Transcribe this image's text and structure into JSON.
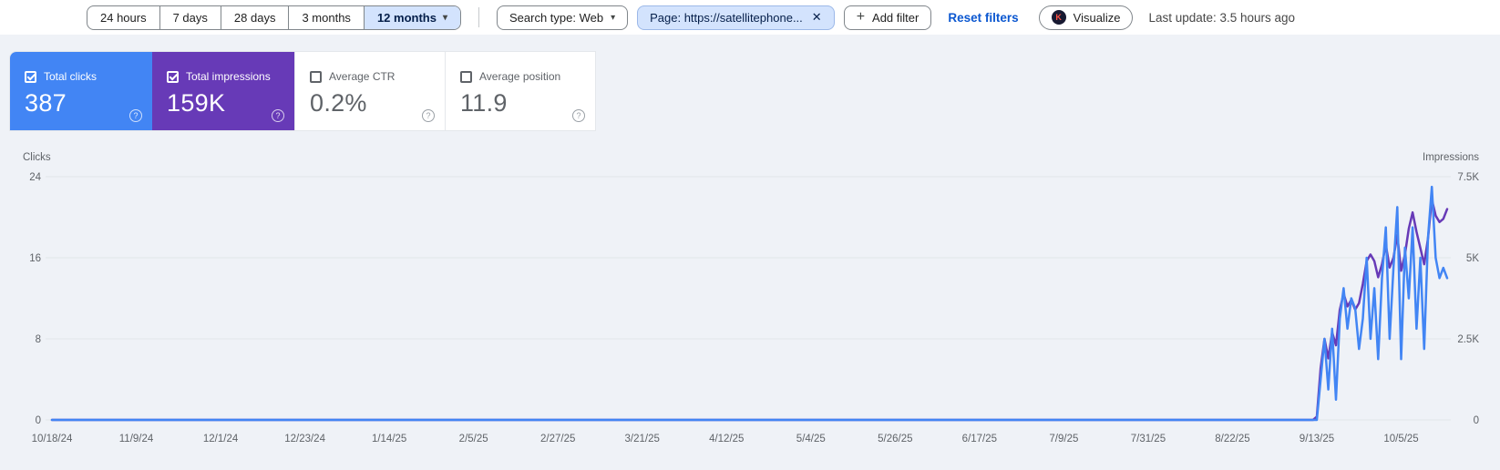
{
  "icons": {
    "caret": "▾",
    "close": "✕",
    "add": "+",
    "help": "?",
    "visualize_logo": "K"
  },
  "toolbar": {
    "date_ranges": [
      {
        "label": "24 hours",
        "selected": false
      },
      {
        "label": "7 days",
        "selected": false
      },
      {
        "label": "28 days",
        "selected": false
      },
      {
        "label": "3 months",
        "selected": false
      },
      {
        "label": "12 months",
        "selected": true
      }
    ],
    "search_type_chip": "Search type: Web",
    "page_filter_chip": "Page: https://satellitephone...",
    "add_filter_label": "Add filter",
    "reset_filters_label": "Reset filters",
    "visualize_label": "Visualize",
    "last_update": "Last update: 3.5 hours ago"
  },
  "metric_cards": [
    {
      "label": "Total clicks",
      "value": "387",
      "checked": true,
      "color": "#4285f4"
    },
    {
      "label": "Total impressions",
      "value": "159K",
      "checked": true,
      "color": "#673ab7"
    },
    {
      "label": "Average CTR",
      "value": "0.2%",
      "checked": false,
      "color": "#ffffff"
    },
    {
      "label": "Average position",
      "value": "11.9",
      "checked": false,
      "color": "#ffffff"
    }
  ],
  "chart_data": {
    "type": "line",
    "title": "Search performance over time (clicks and impressions, daily)",
    "days_total": 365,
    "x_axis": {
      "start_date": "10/18/24",
      "end_date": "10/17/25",
      "tick_interval_days": 22,
      "tick_labels": [
        "10/18/24",
        "11/9/24",
        "12/1/24",
        "12/23/24",
        "1/14/25",
        "2/5/25",
        "2/27/25",
        "3/21/25",
        "4/12/25",
        "5/4/25",
        "5/26/25",
        "6/17/25",
        "7/9/25",
        "7/31/25",
        "8/22/25",
        "9/13/25",
        "10/5/25"
      ]
    },
    "left_axis": {
      "label": "Clicks",
      "ticks": [
        0,
        8,
        16,
        24
      ],
      "tick_labels": [
        "0",
        "8",
        "16",
        "24"
      ],
      "max": 24
    },
    "right_axis": {
      "label": "Impressions",
      "ticks": [
        0,
        2500,
        5000,
        7500
      ],
      "tick_labels": [
        "0",
        "2.5K",
        "5K",
        "7.5K"
      ],
      "max": 7500
    },
    "grid": true,
    "series": [
      {
        "name": "Impressions",
        "axis": "right",
        "color": "#673ab7",
        "flat_days": 330,
        "spike_start_date": "9/12/25",
        "spike_values": [
          100,
          1600,
          2500,
          1900,
          2700,
          2300,
          3400,
          3900,
          3500,
          3700,
          3400,
          3600,
          4200,
          4900,
          5100,
          4900,
          4400,
          4800,
          5400,
          4700,
          5000,
          5700,
          4600,
          5100,
          5900,
          6400,
          5800,
          5300,
          4800,
          5600,
          6800,
          6300,
          6100,
          6200,
          6500
        ]
      },
      {
        "name": "Clicks",
        "axis": "left",
        "color": "#4285f4",
        "flat_days": 330,
        "spike_start_date": "9/12/25",
        "spike_values": [
          0,
          4,
          8,
          3,
          9,
          2,
          10,
          13,
          9,
          12,
          11,
          7,
          10,
          16,
          8,
          13,
          6,
          14,
          19,
          8,
          15,
          21,
          6,
          17,
          12,
          19,
          9,
          16,
          7,
          18,
          23,
          16,
          14,
          15,
          14
        ]
      }
    ]
  }
}
